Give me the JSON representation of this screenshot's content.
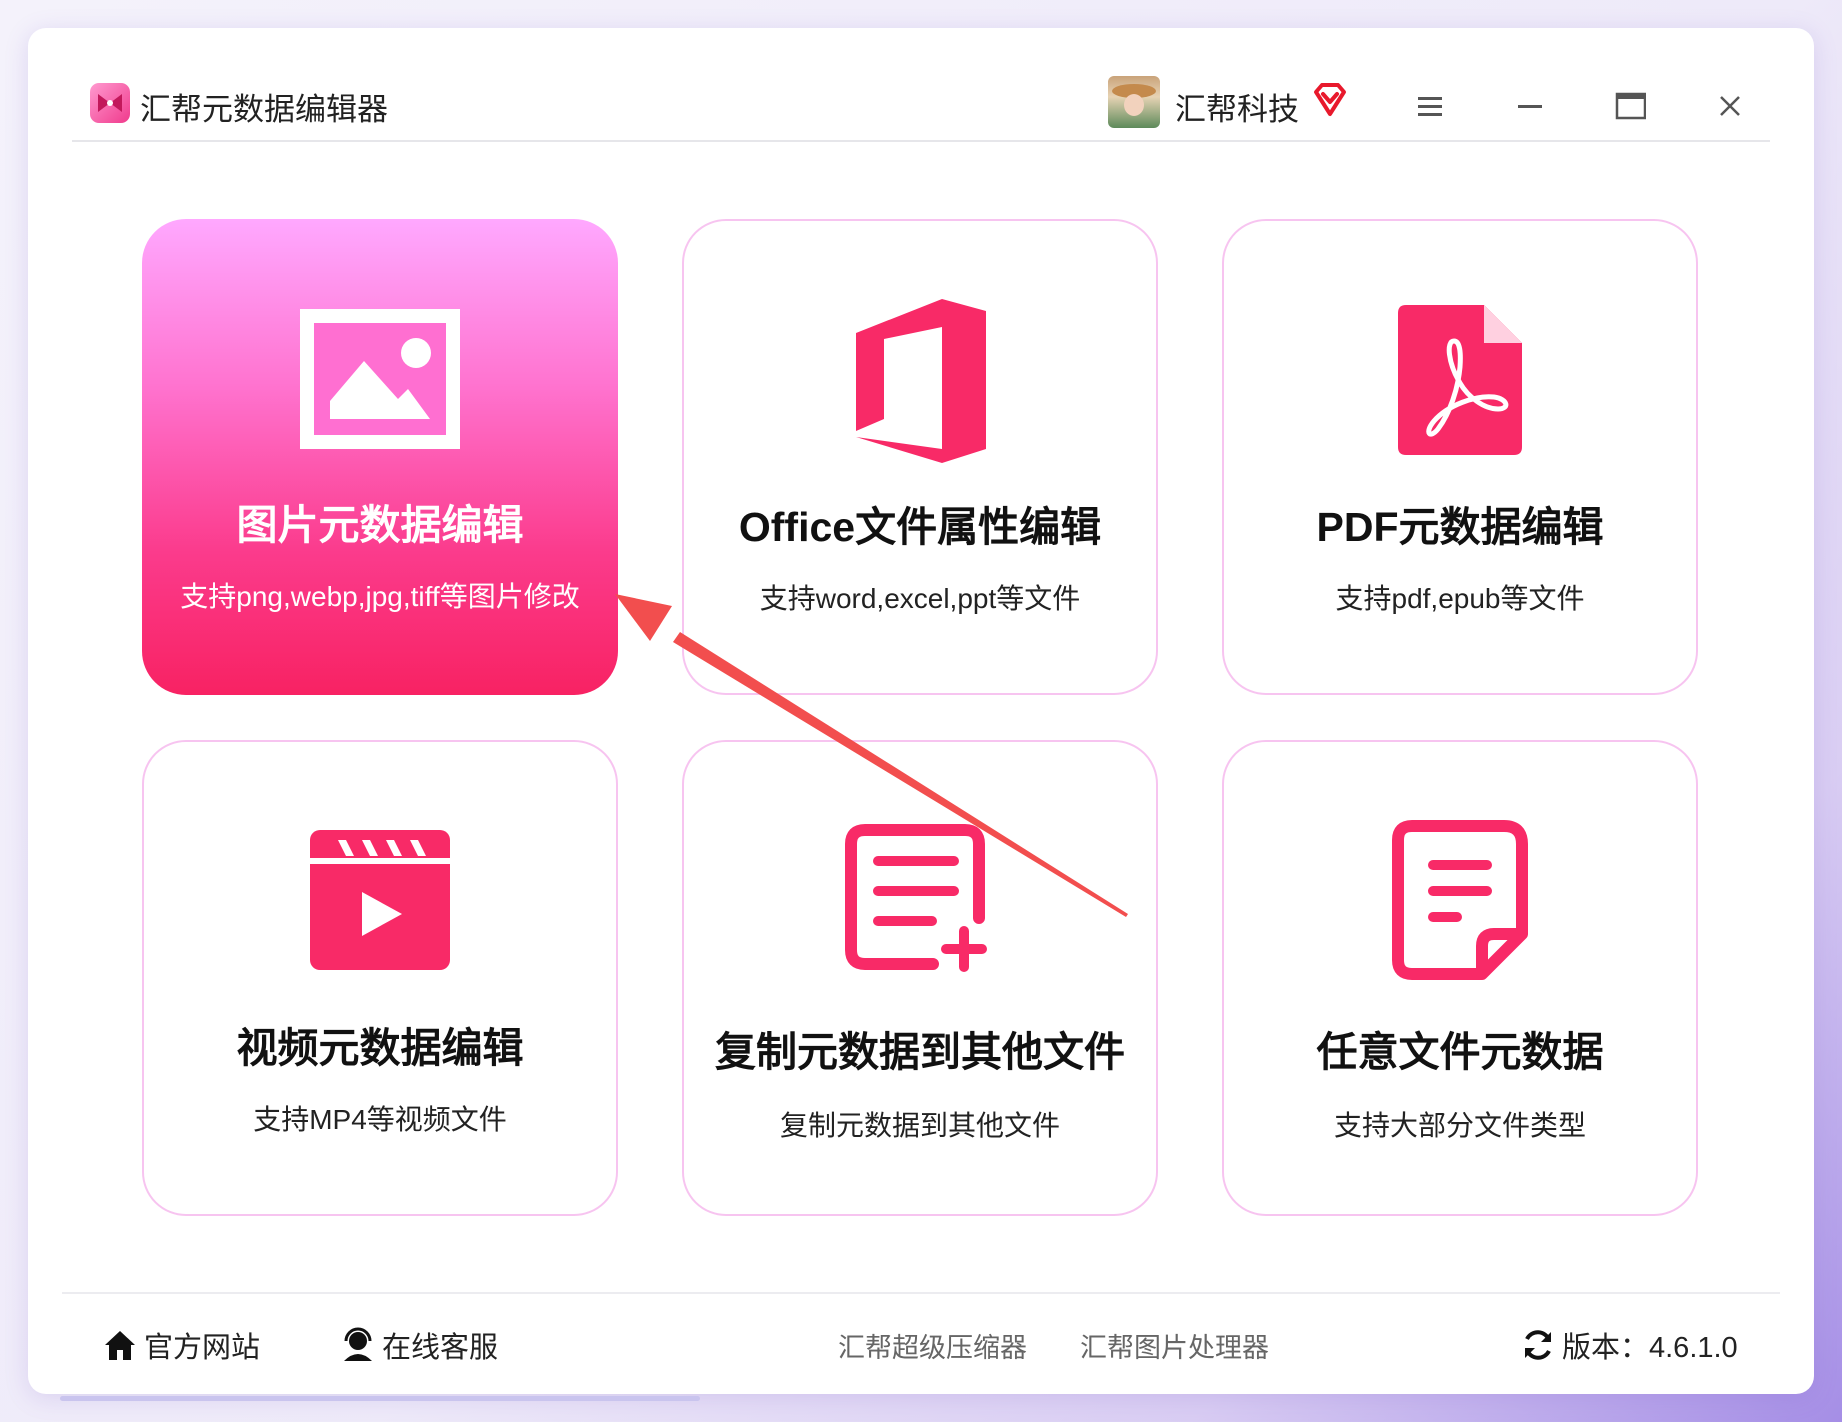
{
  "app": {
    "title": "汇帮元数据编辑器",
    "logo_icon": "bowtie-logo-icon"
  },
  "user": {
    "name": "汇帮科技",
    "badge_icon": "vip-diamond-icon"
  },
  "window_controls": [
    "menu-icon",
    "minimize-icon",
    "maximize-icon",
    "close-icon"
  ],
  "cards": [
    {
      "title": "图片元数据编辑",
      "desc": "支持png,webp,jpg,tiff等图片修改",
      "icon": "image-icon",
      "active": true
    },
    {
      "title": "Office文件属性编辑",
      "desc": "支持word,excel,ppt等文件",
      "icon": "office-icon",
      "active": false
    },
    {
      "title": "PDF元数据编辑",
      "desc": "支持pdf,epub等文件",
      "icon": "pdf-icon",
      "active": false
    },
    {
      "title": "视频元数据编辑",
      "desc": "支持MP4等视频文件",
      "icon": "video-icon",
      "active": false
    },
    {
      "title": "复制元数据到其他文件",
      "desc": "复制元数据到其他文件",
      "icon": "copy-add-document-icon",
      "active": false
    },
    {
      "title": "任意文件元数据",
      "desc": "支持大部分文件类型",
      "icon": "document-icon",
      "active": false
    }
  ],
  "footer": {
    "website": "官方网站",
    "support": "在线客服",
    "link1": "汇帮超级压缩器",
    "link2": "汇帮图片处理器",
    "version": "版本：4.6.1.0"
  },
  "colors": {
    "accent": "#f82a67",
    "card_border": "#f7c4f0",
    "active_top": "#ffa8ff",
    "active_bottom": "#f82263"
  }
}
